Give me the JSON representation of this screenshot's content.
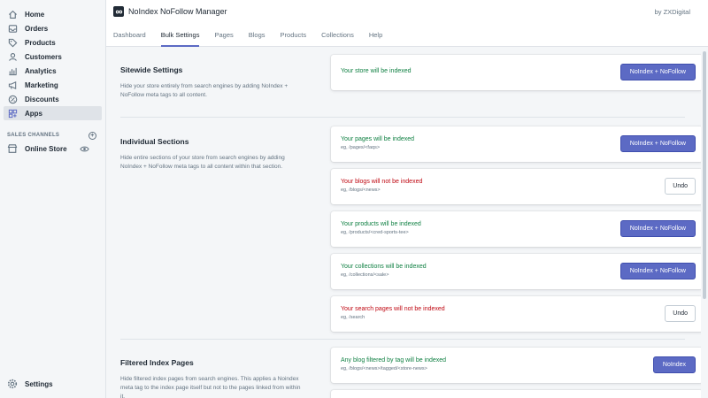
{
  "sidebar": {
    "items": [
      {
        "label": "Home",
        "icon": "home-icon"
      },
      {
        "label": "Orders",
        "icon": "orders-icon"
      },
      {
        "label": "Products",
        "icon": "tag-icon"
      },
      {
        "label": "Customers",
        "icon": "customers-icon"
      },
      {
        "label": "Analytics",
        "icon": "analytics-icon"
      },
      {
        "label": "Marketing",
        "icon": "marketing-icon"
      },
      {
        "label": "Discounts",
        "icon": "discount-icon"
      },
      {
        "label": "Apps",
        "icon": "apps-icon"
      }
    ],
    "active_item": "Apps",
    "sales_channels_label": "SALES CHANNELS",
    "online_store_label": "Online Store",
    "settings_label": "Settings"
  },
  "header": {
    "app_title": "NoIndex NoFollow Manager",
    "by_label": "by ZXDigital",
    "tabs": [
      "Dashboard",
      "Bulk Settings",
      "Pages",
      "Blogs",
      "Products",
      "Collections",
      "Help"
    ],
    "active_tab": "Bulk Settings"
  },
  "sitewide": {
    "title": "Sitewide Settings",
    "description": "Hide your store entirely from search engines by adding NoIndex + NoFollow meta tags to all content.",
    "card": {
      "status": "Your store will be indexed",
      "button": "NoIndex + NoFollow"
    }
  },
  "individual": {
    "title": "Individual Sections",
    "description": "Hide entire sections of your store from search engines by adding NoIndex + NoFollow meta tags to all content within that section.",
    "cards": [
      {
        "status": "Your pages will be indexed",
        "example": "eg, /pages/<faqs>",
        "button": "NoIndex + NoFollow"
      },
      {
        "status": "Your blogs will not be indexed",
        "example": "eg, /blogs/<news>",
        "button": "Undo"
      },
      {
        "status": "Your products will be indexed",
        "example": "eg, /products/<cred-sports-tee>",
        "button": "NoIndex + NoFollow"
      },
      {
        "status": "Your collections will be indexed",
        "example": "eg, /collections/<sale>",
        "button": "NoIndex + NoFollow"
      },
      {
        "status": "Your search pages will not be indexed",
        "example": "eg, /search",
        "button": "Undo"
      }
    ]
  },
  "filtered": {
    "title": "Filtered Index Pages",
    "description": "Hide filtered index pages from search engines. This applies a Noindex meta tag to the index page itself but not to the pages linked from within it.",
    "card": {
      "status": "Any blog filtered by tag will be indexed",
      "example": "eg, /blogs/<news>/tagged/<store-news>",
      "button": "NoIndex"
    }
  },
  "colors": {
    "primary": "#5c6ac4",
    "indexed": "#108043",
    "not_indexed": "#bf0711"
  }
}
